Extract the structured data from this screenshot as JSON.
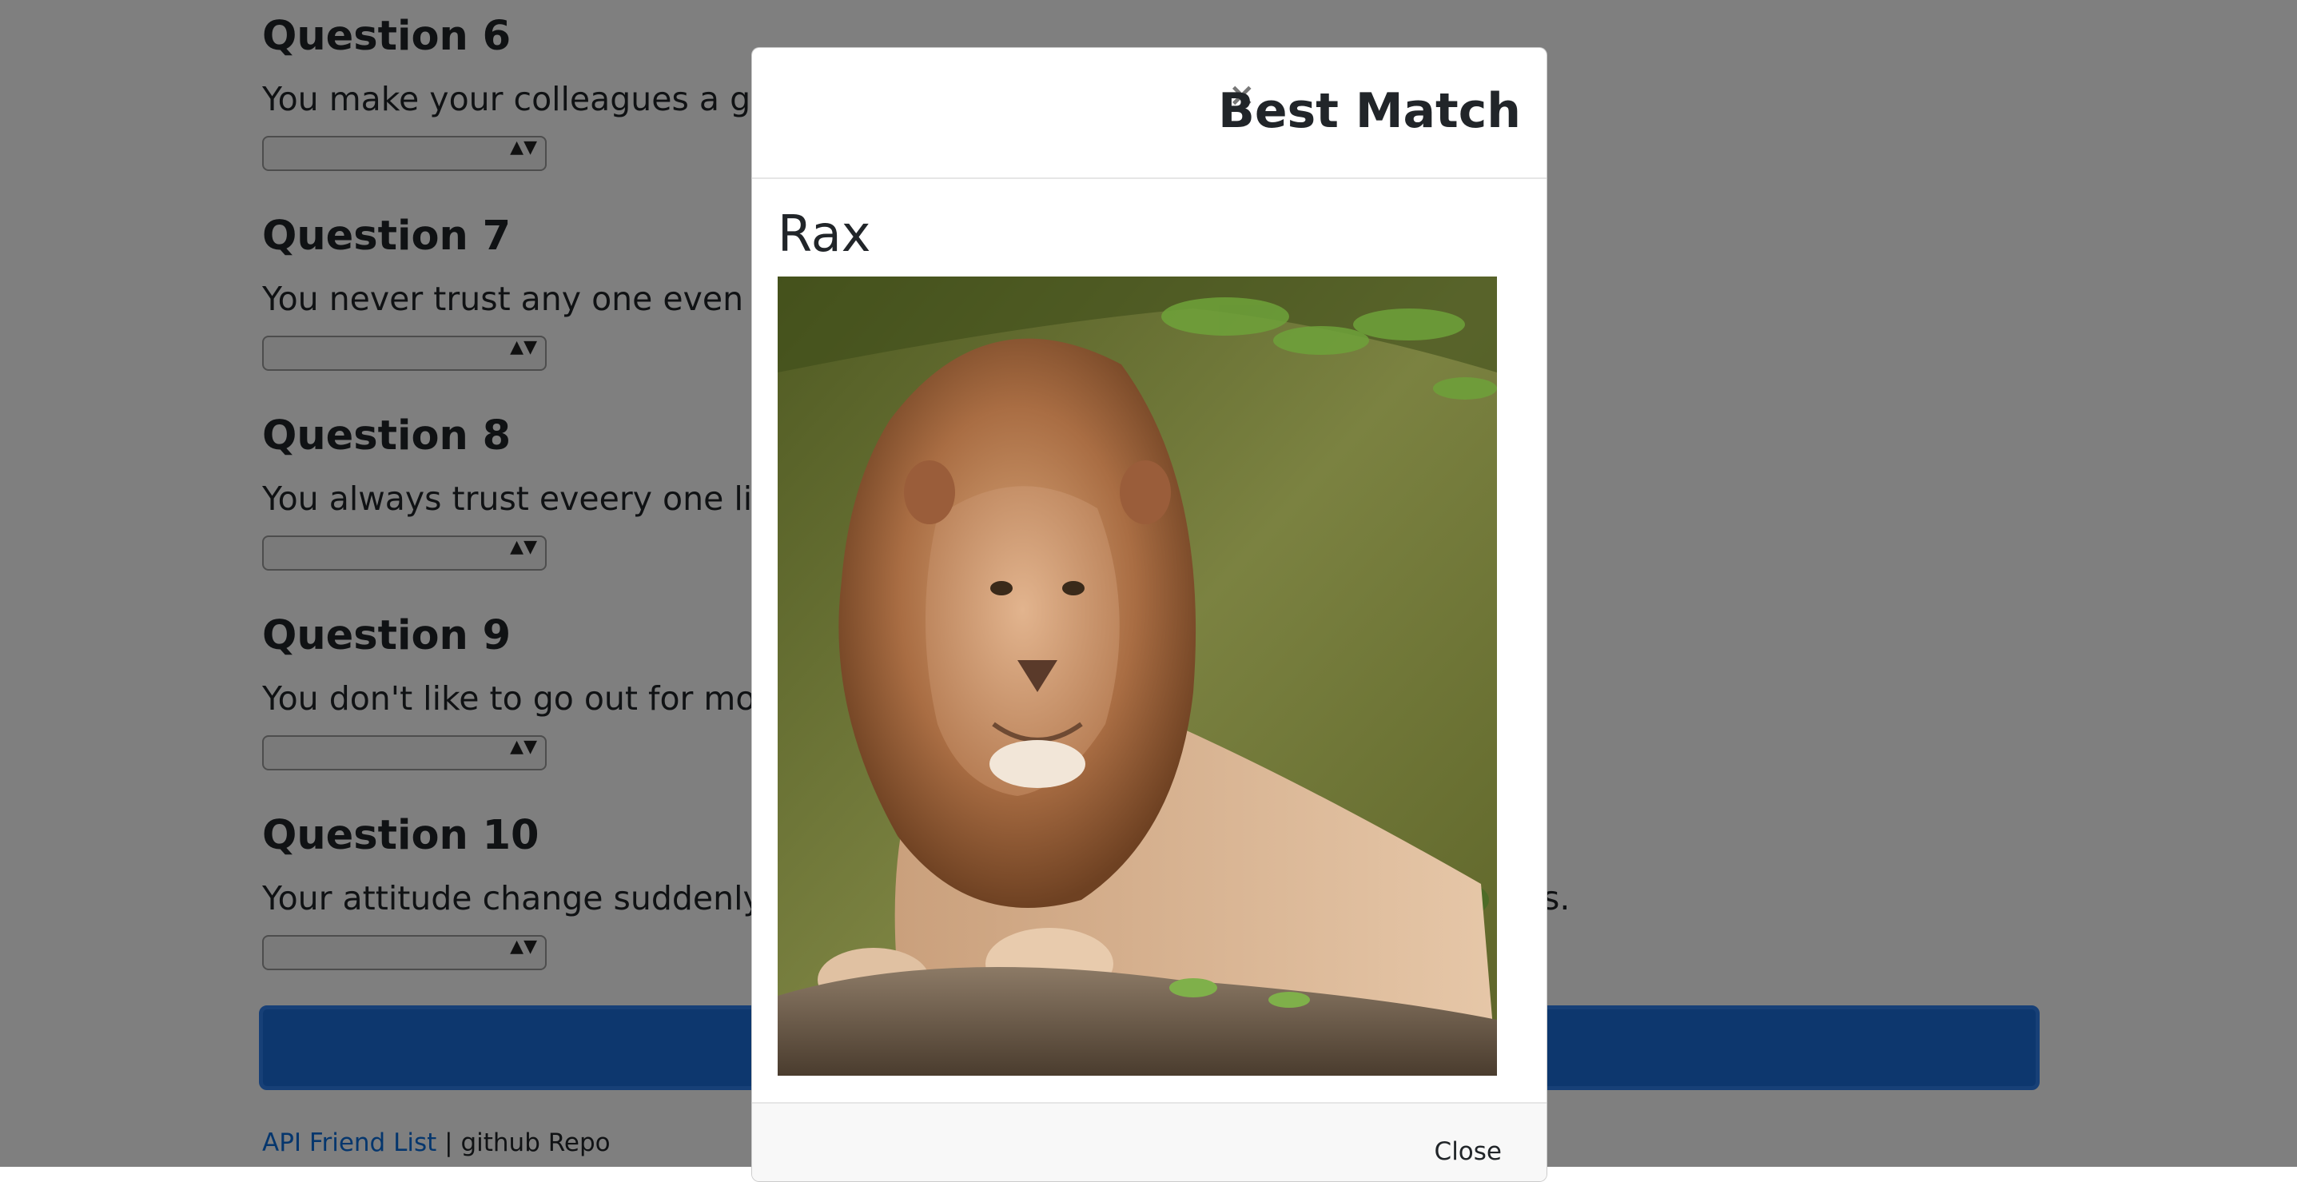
{
  "questions": [
    {
      "title": "Question 6",
      "text": "You make your colleagues a go"
    },
    {
      "title": "Question 7",
      "text": "You never trust any one even y"
    },
    {
      "title": "Question 8",
      "text": "You always trust eveery one lik"
    },
    {
      "title": "Question 9",
      "text": "You don't like to go out for mov"
    },
    {
      "title": "Question 10",
      "text": "Your attitude change suddenly"
    }
  ],
  "q10_text_tail": "s.",
  "select_arrows": "▲▼",
  "footer": {
    "api_link": "API Friend List",
    "separator": "|",
    "github": "github Repo"
  },
  "modal": {
    "close_x": "×",
    "title": "Best Match",
    "match_name": "Rax",
    "photo_subject": "lion-photo",
    "close_button": "Close"
  },
  "colors": {
    "submit_button": "#1a6fdc",
    "link": "#0a6cdb",
    "backdrop": "rgba(0,0,0,0.5)"
  }
}
